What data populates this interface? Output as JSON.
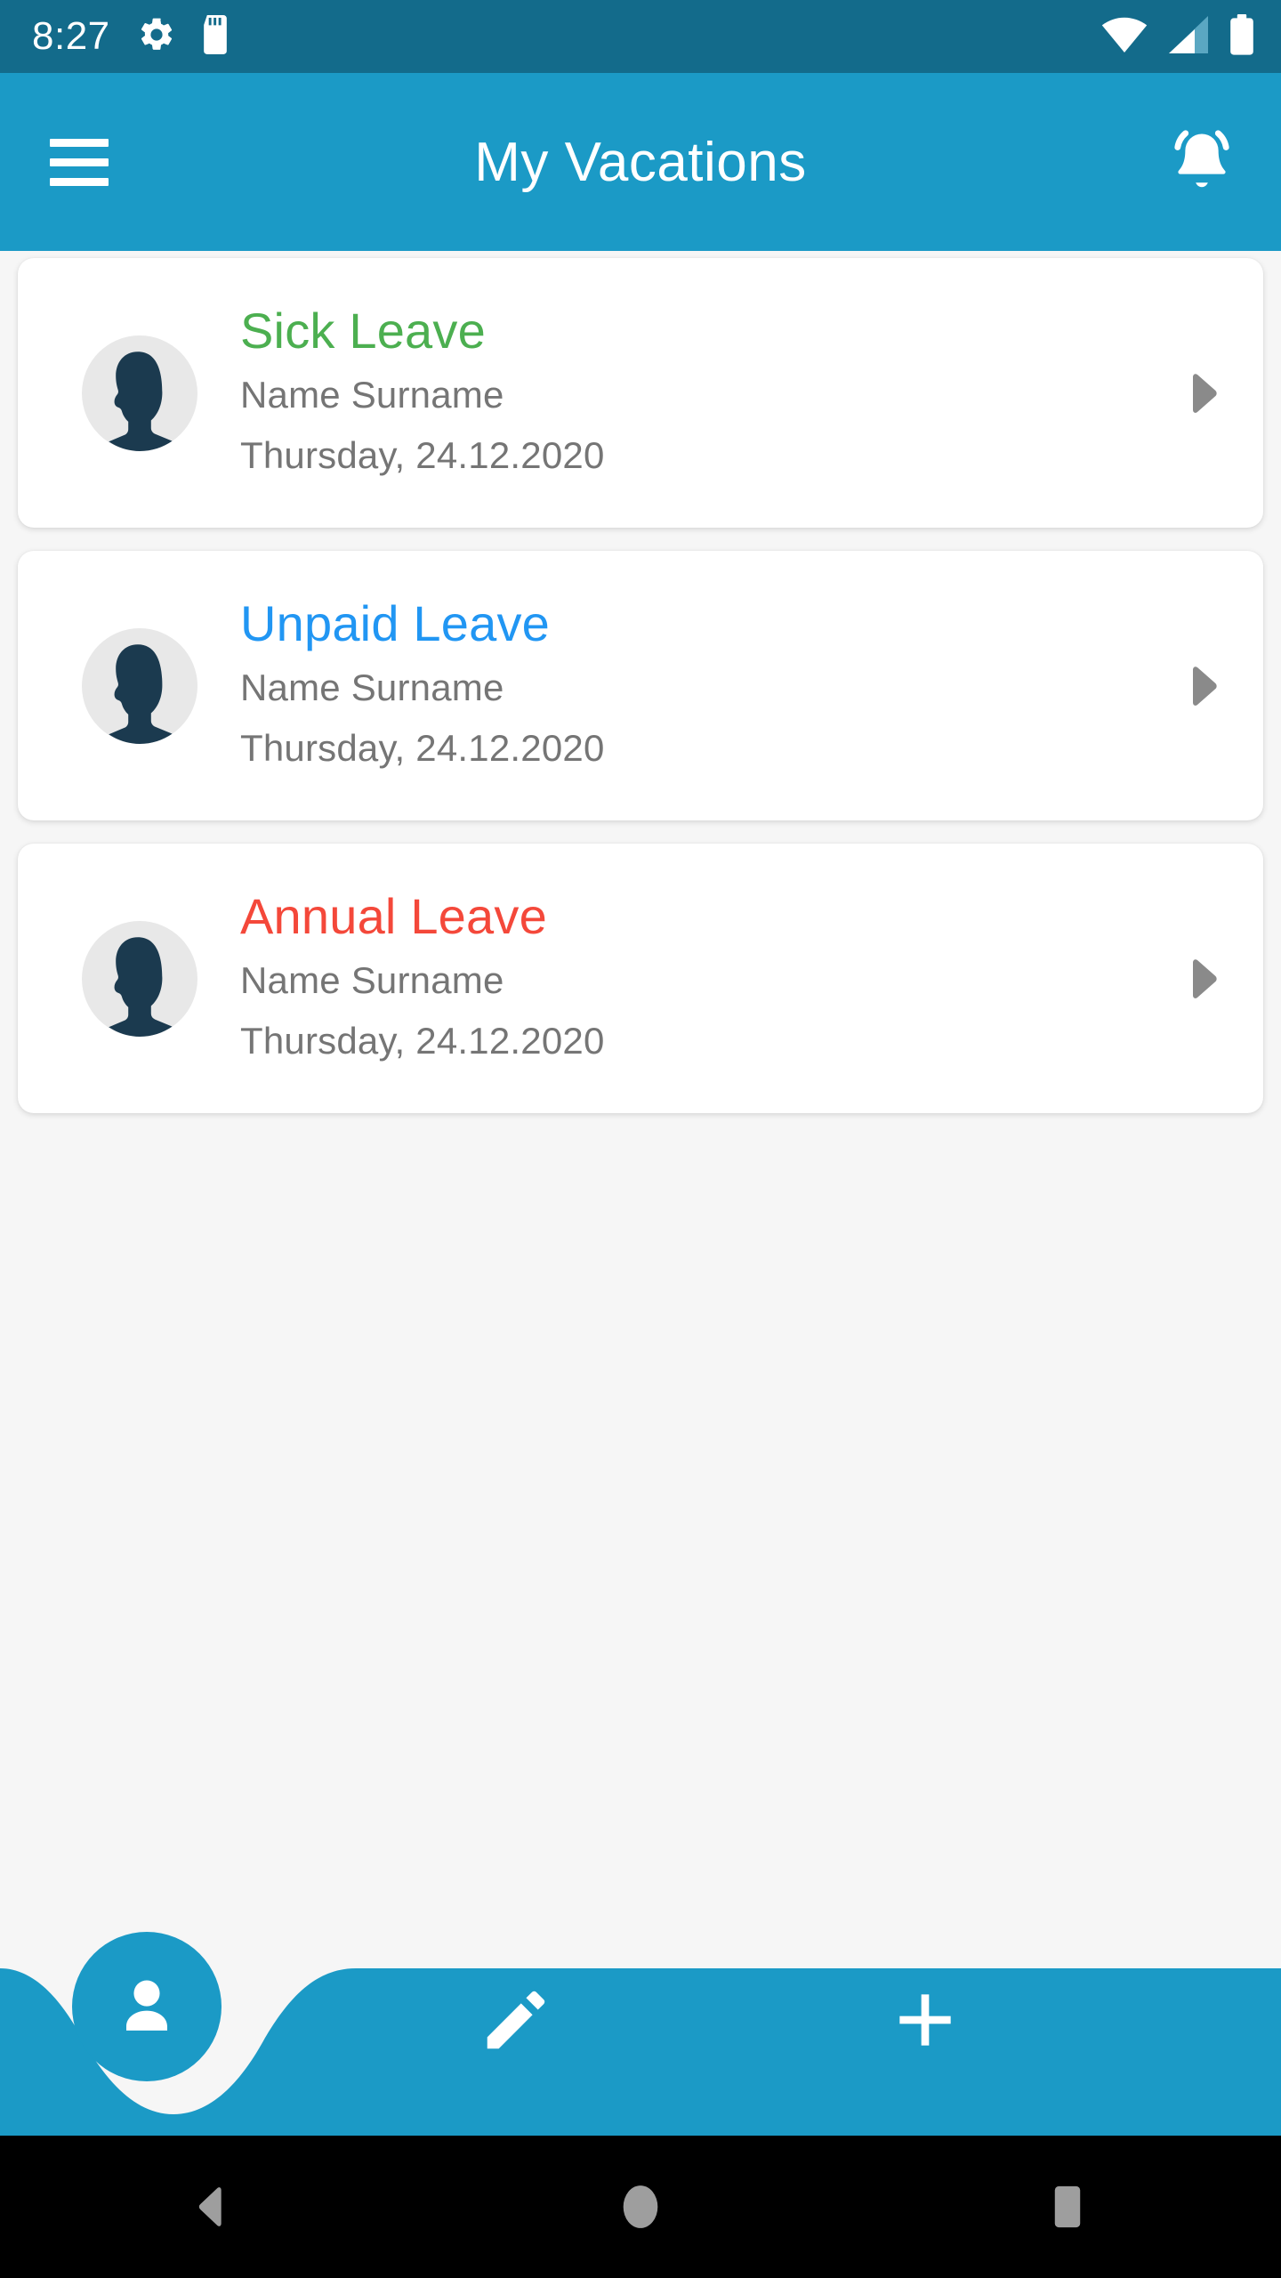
{
  "status_bar": {
    "time": "8:27",
    "background": "#136b8b",
    "icons": [
      "settings-gear-icon",
      "sd-card-icon"
    ],
    "right_icons": [
      "wifi-icon",
      "cellular-signal-icon",
      "battery-icon"
    ]
  },
  "app_bar": {
    "title": "My Vacations",
    "background": "#1b9ac6",
    "menu_icon": "hamburger-menu-icon",
    "notification_icon": "notifications-active-bell-icon"
  },
  "list": {
    "items": [
      {
        "title": "Sick Leave",
        "color": "#4caf50",
        "name": "Name Surname",
        "date": "Thursday, 24.12.2020",
        "avatar": "person-avatar",
        "chevron": "chevron-right-icon"
      },
      {
        "title": "Unpaid Leave",
        "color": "#2196f3",
        "name": "Name Surname",
        "date": "Thursday, 24.12.2020",
        "avatar": "person-avatar",
        "chevron": "chevron-right-icon"
      },
      {
        "title": "Annual Leave",
        "color": "#f4483a",
        "name": "Name Surname",
        "date": "Thursday, 24.12.2020",
        "avatar": "person-avatar",
        "chevron": "chevron-right-icon"
      }
    ]
  },
  "bottom_bar": {
    "background": "#1b9ac6",
    "profile_fab_icon": "person-icon",
    "edit_icon": "pencil-edit-icon",
    "add_icon": "plus-icon"
  },
  "android_nav": {
    "back_icon": "back-triangle-icon",
    "home_icon": "home-circle-icon",
    "recents_icon": "recents-square-icon",
    "background": "#000000",
    "icon_color": "#9e9e9e"
  },
  "theme": {
    "page_background": "#f6f6f6",
    "card_background": "#ffffff",
    "secondary_text": "#757575",
    "avatar_silhouette": "#1b3a4f",
    "avatar_backdrop": "#e8e8e8",
    "chevron_color": "#8a8a8a"
  }
}
